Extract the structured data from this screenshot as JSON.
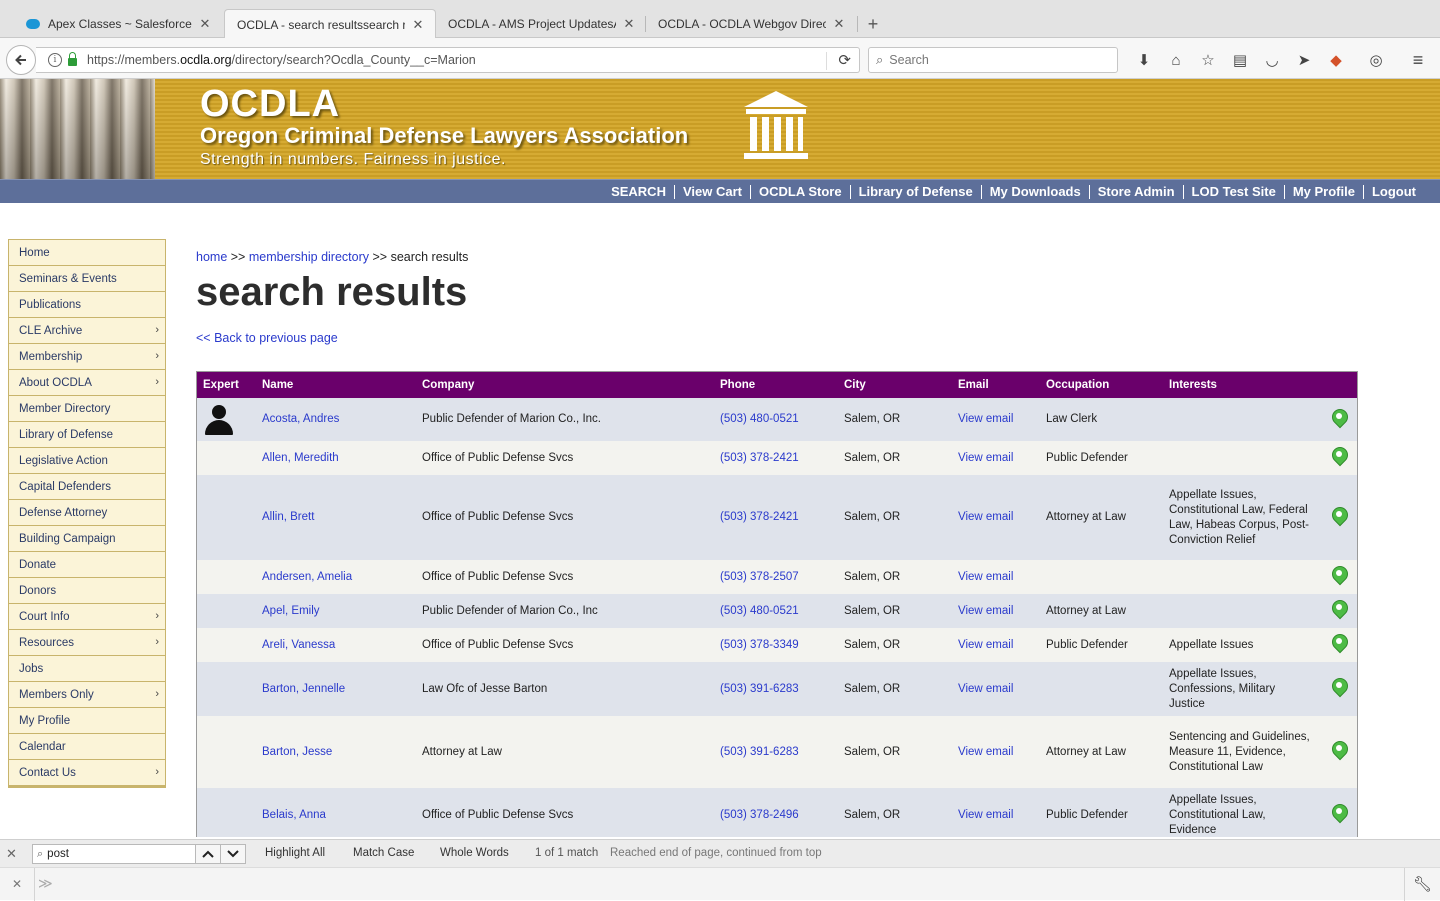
{
  "browser": {
    "tabs": [
      {
        "label": "Apex Classes ~ Salesforce - E"
      },
      {
        "label": "OCDLA - search resultssearch re"
      },
      {
        "label": "OCDLA - AMS Project UpdatesAM"
      },
      {
        "label": "OCDLA - OCDLA Webgov Directo"
      }
    ],
    "url_prefix": "https://members.",
    "url_domain": "ocdla.org",
    "url_path": "/directory/search?Ocdla_County__c=Marion",
    "search_placeholder": "Search",
    "newtab_symbol": "+"
  },
  "header": {
    "abbr": "OCDLA",
    "name": "Oregon Criminal Defense Lawyers Association",
    "tagline": "Strength in numbers. Fairness in justice.",
    "accent": "#d6ab33"
  },
  "topnav": [
    "SEARCH",
    "View Cart",
    "OCDLA Store",
    "Library of Defense",
    "My Downloads",
    "Store Admin",
    "LOD Test Site",
    "My Profile",
    "Logout"
  ],
  "sidebar": [
    {
      "label": "Home",
      "arrow": ""
    },
    {
      "label": "Seminars & Events",
      "arrow": ""
    },
    {
      "label": "Publications",
      "arrow": ""
    },
    {
      "label": "CLE Archive",
      "arrow": "›"
    },
    {
      "label": "Membership",
      "arrow": "›"
    },
    {
      "label": "About OCDLA",
      "arrow": "›"
    },
    {
      "label": "Member Directory",
      "arrow": ""
    },
    {
      "label": "Library of Defense",
      "arrow": ""
    },
    {
      "label": "Legislative Action",
      "arrow": ""
    },
    {
      "label": "Capital Defenders",
      "arrow": ""
    },
    {
      "label": "Defense Attorney",
      "arrow": ""
    },
    {
      "label": "Building Campaign",
      "arrow": ""
    },
    {
      "label": "Donate",
      "arrow": ""
    },
    {
      "label": "Donors",
      "arrow": ""
    },
    {
      "label": "Court Info",
      "arrow": "›"
    },
    {
      "label": "Resources",
      "arrow": "›"
    },
    {
      "label": "Jobs",
      "arrow": ""
    },
    {
      "label": "Members Only",
      "arrow": "›"
    },
    {
      "label": "My Profile",
      "arrow": ""
    },
    {
      "label": "Calendar",
      "arrow": ""
    },
    {
      "label": "Contact Us",
      "arrow": "›"
    }
  ],
  "breadcrumb": {
    "home": "home",
    "sep1": " >> ",
    "directory": "membership directory",
    "sep2": " >> ",
    "current": "search results"
  },
  "page_title": "search results",
  "back_link": "<< Back to previous page",
  "table": {
    "headers": [
      "Expert",
      "Name",
      "Company",
      "Phone",
      "City",
      "Email",
      "Occupation",
      "Interests",
      ""
    ],
    "header_bg": "#6a006b",
    "rows": [
      {
        "expert": true,
        "name": "Acosta, Andres",
        "company": "Public Defender of Marion Co., Inc.",
        "phone": "(503) 480-0521",
        "city": "Salem, OR",
        "email": "View email",
        "occupation": "Law Clerk",
        "interests": ""
      },
      {
        "expert": false,
        "name": "Allen, Meredith",
        "company": "Office of Public Defense Svcs",
        "phone": "(503) 378-2421",
        "city": "Salem, OR",
        "email": "View email",
        "occupation": "Public Defender",
        "interests": ""
      },
      {
        "expert": false,
        "name": "Allin, Brett",
        "company": "Office of Public Defense Svcs",
        "phone": "(503) 378-2421",
        "city": "Salem, OR",
        "email": "View email",
        "occupation": "Attorney at Law",
        "interests": "Appellate Issues, Constitutional Law, Federal Law, Habeas Corpus, Post-Conviction Relief"
      },
      {
        "expert": false,
        "name": "Andersen, Amelia",
        "company": "Office of Public Defense Svcs",
        "phone": "(503) 378-2507",
        "city": "Salem, OR",
        "email": "View email",
        "occupation": "",
        "interests": ""
      },
      {
        "expert": false,
        "name": "Apel, Emily",
        "company": "Public Defender of Marion Co., Inc",
        "phone": "(503) 480-0521",
        "city": "Salem, OR",
        "email": "View email",
        "occupation": "Attorney at Law",
        "interests": ""
      },
      {
        "expert": false,
        "name": "Areli, Vanessa",
        "company": "Office of Public Defense Svcs",
        "phone": "(503) 378-3349",
        "city": "Salem, OR",
        "email": "View email",
        "occupation": "Public Defender",
        "interests": "Appellate Issues"
      },
      {
        "expert": false,
        "name": "Barton, Jennelle",
        "company": "Law Ofc of Jesse Barton",
        "phone": "(503) 391-6283",
        "city": "Salem, OR",
        "email": "View email",
        "occupation": "",
        "interests": "Appellate Issues, Confessions, Military Justice"
      },
      {
        "expert": false,
        "name": "Barton, Jesse",
        "company": "Attorney at Law",
        "phone": "(503) 391-6283",
        "city": "Salem, OR",
        "email": "View email",
        "occupation": "Attorney at Law",
        "interests": "Sentencing and Guidelines, Measure 11, Evidence, Constitutional Law"
      },
      {
        "expert": false,
        "name": "Belais, Anna",
        "company": "Office of Public Defense Svcs",
        "phone": "(503) 378-2496",
        "city": "Salem, OR",
        "email": "View email",
        "occupation": "Public Defender",
        "interests": "Appellate Issues, Constitutional Law, Evidence"
      }
    ]
  },
  "findbar": {
    "value": "post",
    "highlight_all": "Highlight All",
    "match_case": "Match Case",
    "whole_words": "Whole Words",
    "match_count": "1 of 1 match",
    "status": "Reached end of page, continued from top"
  }
}
